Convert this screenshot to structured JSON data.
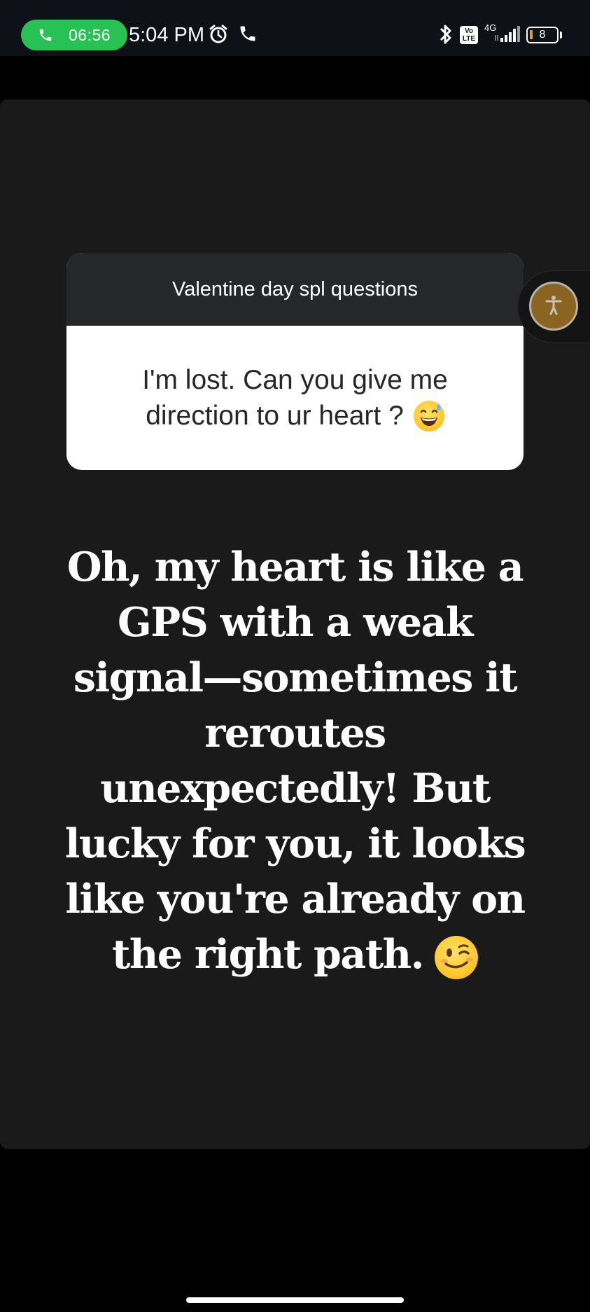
{
  "status_bar": {
    "call_duration": "06:56",
    "clock": "5:04 PM",
    "volte_label_top": "Vo",
    "volte_label_bottom": "LTE",
    "network_type": "4G",
    "battery_level": "8",
    "icons": [
      "phone-icon",
      "alarm-icon",
      "call-icon",
      "bluetooth-icon",
      "volte-icon",
      "signal-icon",
      "battery-icon"
    ]
  },
  "question_sticker": {
    "header": "Valentine day spl questions",
    "question_line1": "I'm lost. Can you give me",
    "question_line2": "direction to ur heart ?",
    "question_emoji": "grinning-face-with-sweat"
  },
  "answer": {
    "lines": [
      "Oh, my heart is like a",
      "GPS with a weak",
      "signal—sometimes it",
      "reroutes",
      "unexpectedly! But",
      "lucky for you, it looks",
      "like you're already on",
      "the right path."
    ],
    "emoji": "winking-face"
  },
  "accessibility_button": {
    "icon": "accessibility-person-icon"
  },
  "colors": {
    "status_bar_bg": "#0e1117",
    "call_pill": "#28c254",
    "canvas_bg": "#1a1a1a",
    "sticker_header_bg": "#26272a",
    "sticker_body_bg": "#ffffff",
    "accessibility_button": "#8a6420"
  }
}
